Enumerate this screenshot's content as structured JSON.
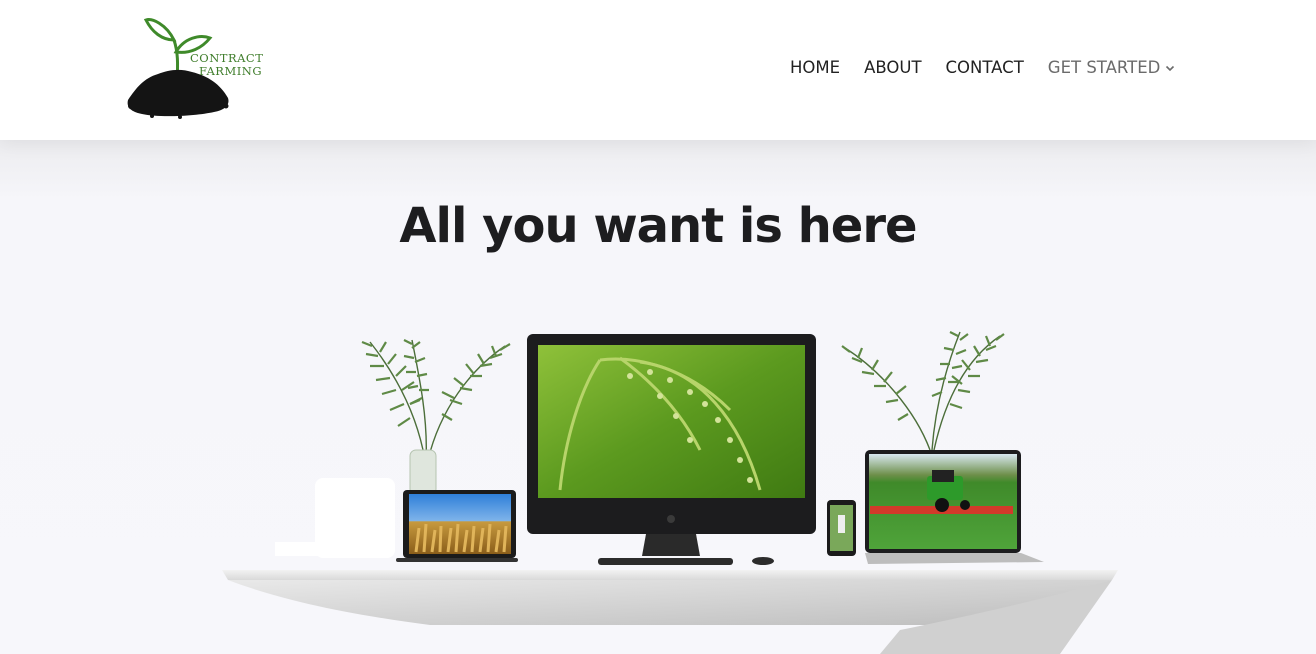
{
  "brand": {
    "logo_line1": "CONTRACT",
    "logo_line2": "FARMING",
    "accent": "#3f7d2b"
  },
  "nav": {
    "items": [
      {
        "label": "HOME"
      },
      {
        "label": "ABOUT"
      },
      {
        "label": "CONTACT"
      },
      {
        "label": "GET STARTED",
        "icon": "chevron-down-icon"
      }
    ]
  },
  "hero": {
    "title": "All you want is here"
  }
}
